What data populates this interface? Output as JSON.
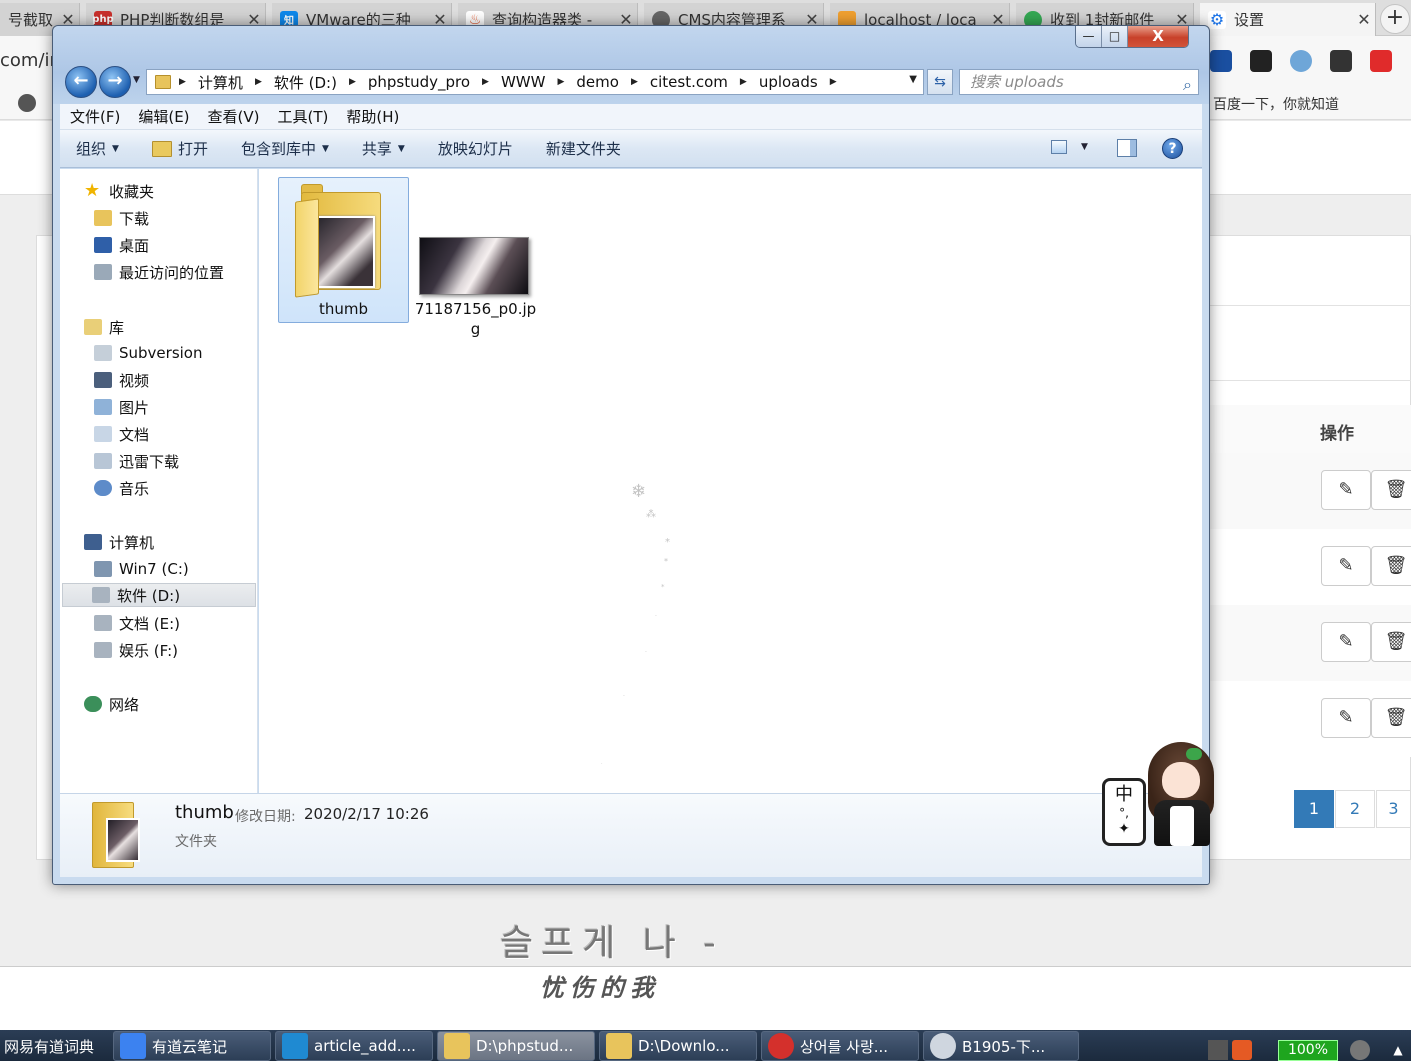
{
  "browser": {
    "tabs": [
      {
        "label": "号截取",
        "icon": "blank-icon",
        "color": "#d3d3d3"
      },
      {
        "label": "PHP判断数组是",
        "icon": "php-icon",
        "color": "#c9302c"
      },
      {
        "label": "VMware的三种",
        "icon": "zhihu-icon",
        "color": "#0f88eb"
      },
      {
        "label": "查询构造器类 -",
        "icon": "flame-icon",
        "color": "#e4572e"
      },
      {
        "label": "CMS内容管理系",
        "icon": "globe-icon",
        "color": "#555555"
      },
      {
        "label": "localhost / loca",
        "icon": "pma-icon",
        "color": "#f0a030"
      },
      {
        "label": "收到 1封新邮件",
        "icon": "mail-icon",
        "color": "#34a853"
      },
      {
        "label": "设置",
        "icon": "gear-icon",
        "color": "#1a73e8"
      }
    ],
    "address_partial": "com/ir",
    "bookmark_text": "百度一下，你就知道"
  },
  "page": {
    "column_header": "操作",
    "row_actions": [
      {
        "edit": "✎",
        "delete": "🗑"
      },
      {
        "edit": "✎",
        "delete": "🗑"
      },
      {
        "edit": "✎",
        "delete": "🗑"
      },
      {
        "edit": "✎",
        "delete": "🗑"
      }
    ],
    "pagination": [
      "1",
      "2",
      "3"
    ],
    "pagination_current": "1",
    "deco_korean": "슬프게 나 -",
    "deco_chinese": "忧伤的我"
  },
  "explorer": {
    "caption": {
      "minimize": "—",
      "maximize": "□",
      "close": "X"
    },
    "nav": {
      "back": "←",
      "forward": "→"
    },
    "breadcrumb": [
      "计算机",
      "软件 (D:)",
      "phpstudy_pro",
      "WWW",
      "demo",
      "citest.com",
      "uploads"
    ],
    "search_placeholder": "搜索 uploads",
    "menu": [
      "文件(F)",
      "编辑(E)",
      "查看(V)",
      "工具(T)",
      "帮助(H)"
    ],
    "commands": [
      {
        "label": "组织",
        "dropdown": true
      },
      {
        "label": "打开",
        "dropdown": false
      },
      {
        "label": "包含到库中",
        "dropdown": true
      },
      {
        "label": "共享",
        "dropdown": true
      },
      {
        "label": "放映幻灯片",
        "dropdown": false
      },
      {
        "label": "新建文件夹",
        "dropdown": false
      }
    ],
    "help_label": "?",
    "nav_tree": {
      "favorites": {
        "label": "收藏夹",
        "items": [
          "下载",
          "桌面",
          "最近访问的位置"
        ]
      },
      "libraries": {
        "label": "库",
        "items": [
          "Subversion",
          "视频",
          "图片",
          "文档",
          "迅雷下载",
          "音乐"
        ]
      },
      "computer": {
        "label": "计算机",
        "items": [
          "Win7 (C:)",
          "软件 (D:)",
          "文档 (E:)",
          "娱乐 (F:)"
        ]
      },
      "network": {
        "label": "网络"
      }
    },
    "files": [
      {
        "name": "thumb",
        "type": "folder",
        "selected": true
      },
      {
        "name": "71187156_p0.jpg",
        "type": "image",
        "selected": false
      }
    ],
    "details": {
      "name": "thumb",
      "modified_label": "修改日期:",
      "modified_value": "2020/2/17 10:26",
      "type": "文件夹"
    }
  },
  "ime": {
    "mode": "中",
    "punct": "°,",
    "icon": "butterfly-icon"
  },
  "taskbar": {
    "items": [
      {
        "label": "网易有道词典",
        "icon": "dict-icon"
      },
      {
        "label": "有道云笔记",
        "icon": "note-icon"
      },
      {
        "label": "article_add....",
        "icon": "vscode-icon"
      },
      {
        "label": "D:\\phpstud...",
        "icon": "folder-icon"
      },
      {
        "label": "D:\\Downlo...",
        "icon": "folder-icon"
      },
      {
        "label": "상어를 사랑...",
        "icon": "netease-music-icon"
      },
      {
        "label": "B1905-下...",
        "icon": "avatar-icon"
      }
    ],
    "battery": "100%"
  }
}
